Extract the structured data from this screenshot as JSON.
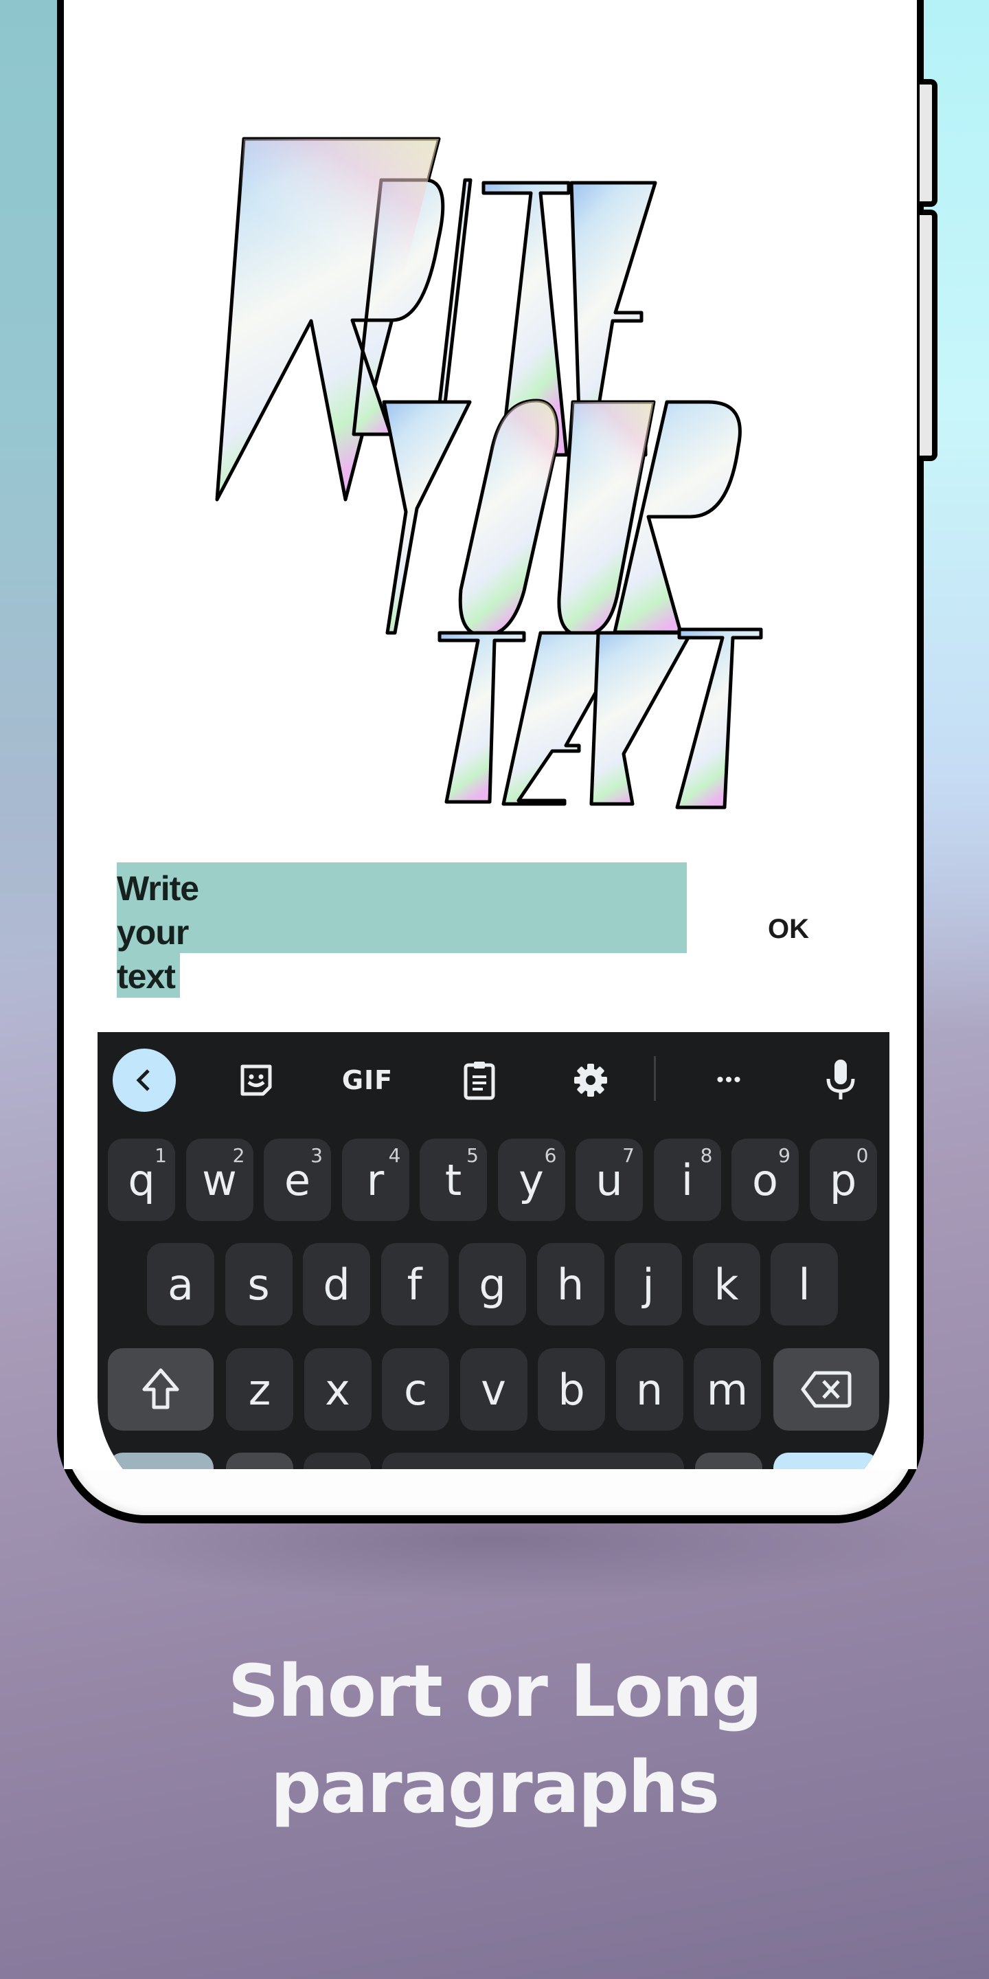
{
  "artwork": {
    "title_lines": [
      "WRITE",
      "YOUR",
      "TEXT"
    ],
    "style": "holographic-outline"
  },
  "text_input": {
    "value_lines": [
      "Write",
      "your",
      "text"
    ],
    "highlight_color": "#9bcfc8"
  },
  "ok_button": {
    "label": "OK"
  },
  "keyboard": {
    "toolbar": [
      {
        "icon": "chevron-left-icon",
        "label": "<"
      },
      {
        "icon": "sticker-icon",
        "label": ""
      },
      {
        "icon": "gif-icon",
        "label": "GIF"
      },
      {
        "icon": "clipboard-icon",
        "label": ""
      },
      {
        "icon": "gear-icon",
        "label": ""
      },
      {
        "icon": "more-icon",
        "label": "•••"
      },
      {
        "icon": "microphone-icon",
        "label": ""
      }
    ],
    "row1": [
      {
        "key": "q",
        "num": "1"
      },
      {
        "key": "w",
        "num": "2"
      },
      {
        "key": "e",
        "num": "3"
      },
      {
        "key": "r",
        "num": "4"
      },
      {
        "key": "t",
        "num": "5"
      },
      {
        "key": "y",
        "num": "6"
      },
      {
        "key": "u",
        "num": "7"
      },
      {
        "key": "i",
        "num": "8"
      },
      {
        "key": "o",
        "num": "9"
      },
      {
        "key": "p",
        "num": "0"
      }
    ],
    "row2": [
      "a",
      "s",
      "d",
      "f",
      "g",
      "h",
      "j",
      "k",
      "l"
    ],
    "row3": [
      "z",
      "x",
      "c",
      "v",
      "b",
      "n",
      "m"
    ],
    "shift_icon": "shift-icon",
    "backspace_icon": "backspace-icon",
    "colors": {
      "background": "#1b1c1e",
      "key": "#2f3033",
      "modifier": "#47484b",
      "accent": "#c2e6fc"
    }
  },
  "caption": {
    "line1": "Short or Long",
    "line2": "paragraphs"
  }
}
